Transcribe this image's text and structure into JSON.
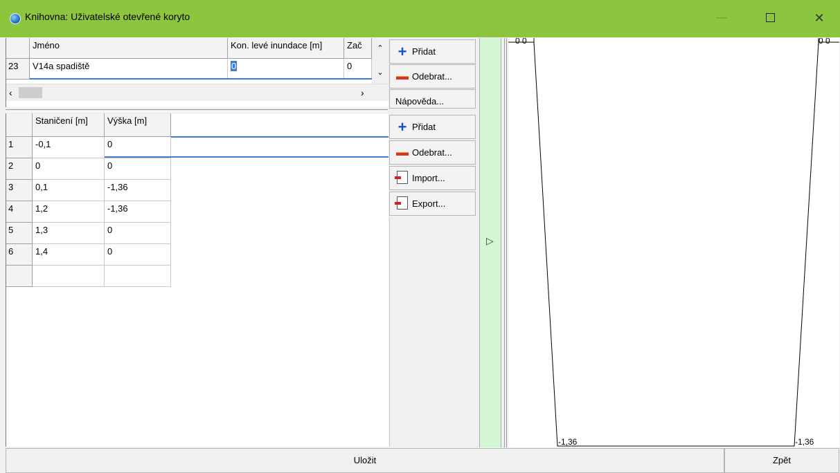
{
  "window": {
    "title": "Knihovna: Uživatelské otevřené koryto"
  },
  "top_table": {
    "columns": [
      "Jméno",
      "Kon. levé inundace [m]",
      "Zač"
    ],
    "row": {
      "num": "23",
      "name": "V14a spadiště",
      "value": "0",
      "zac": "0"
    }
  },
  "top_buttons": {
    "add": "Přidat",
    "remove": "Odebrat...",
    "help": "Nápověda..."
  },
  "profile_table": {
    "columns": [
      "Staničení [m]",
      "Výška [m]"
    ],
    "rows": [
      {
        "num": "1",
        "station": "-0,1",
        "height": "0"
      },
      {
        "num": "2",
        "station": "0",
        "height": "0"
      },
      {
        "num": "3",
        "station": "0,1",
        "height": "-1,36"
      },
      {
        "num": "4",
        "station": "1,2",
        "height": "-1,36"
      },
      {
        "num": "5",
        "station": "1,3",
        "height": "0"
      },
      {
        "num": "6",
        "station": "1,4",
        "height": "0"
      }
    ]
  },
  "profile_buttons": {
    "add": "Přidat",
    "remove": "Odebrat...",
    "import": "Import...",
    "export": "Export..."
  },
  "graph": {
    "top_left_label": "0 0",
    "top_right_label": "0 0",
    "bottom_left_label": "-1,36",
    "bottom_right_label": "-1,36"
  },
  "footer": {
    "save": "Uložit",
    "back": "Zpět"
  },
  "colors": {
    "titlebar": "#8dc53e",
    "splitter": "#d3f7d3",
    "selection": "#3a7fd5"
  }
}
